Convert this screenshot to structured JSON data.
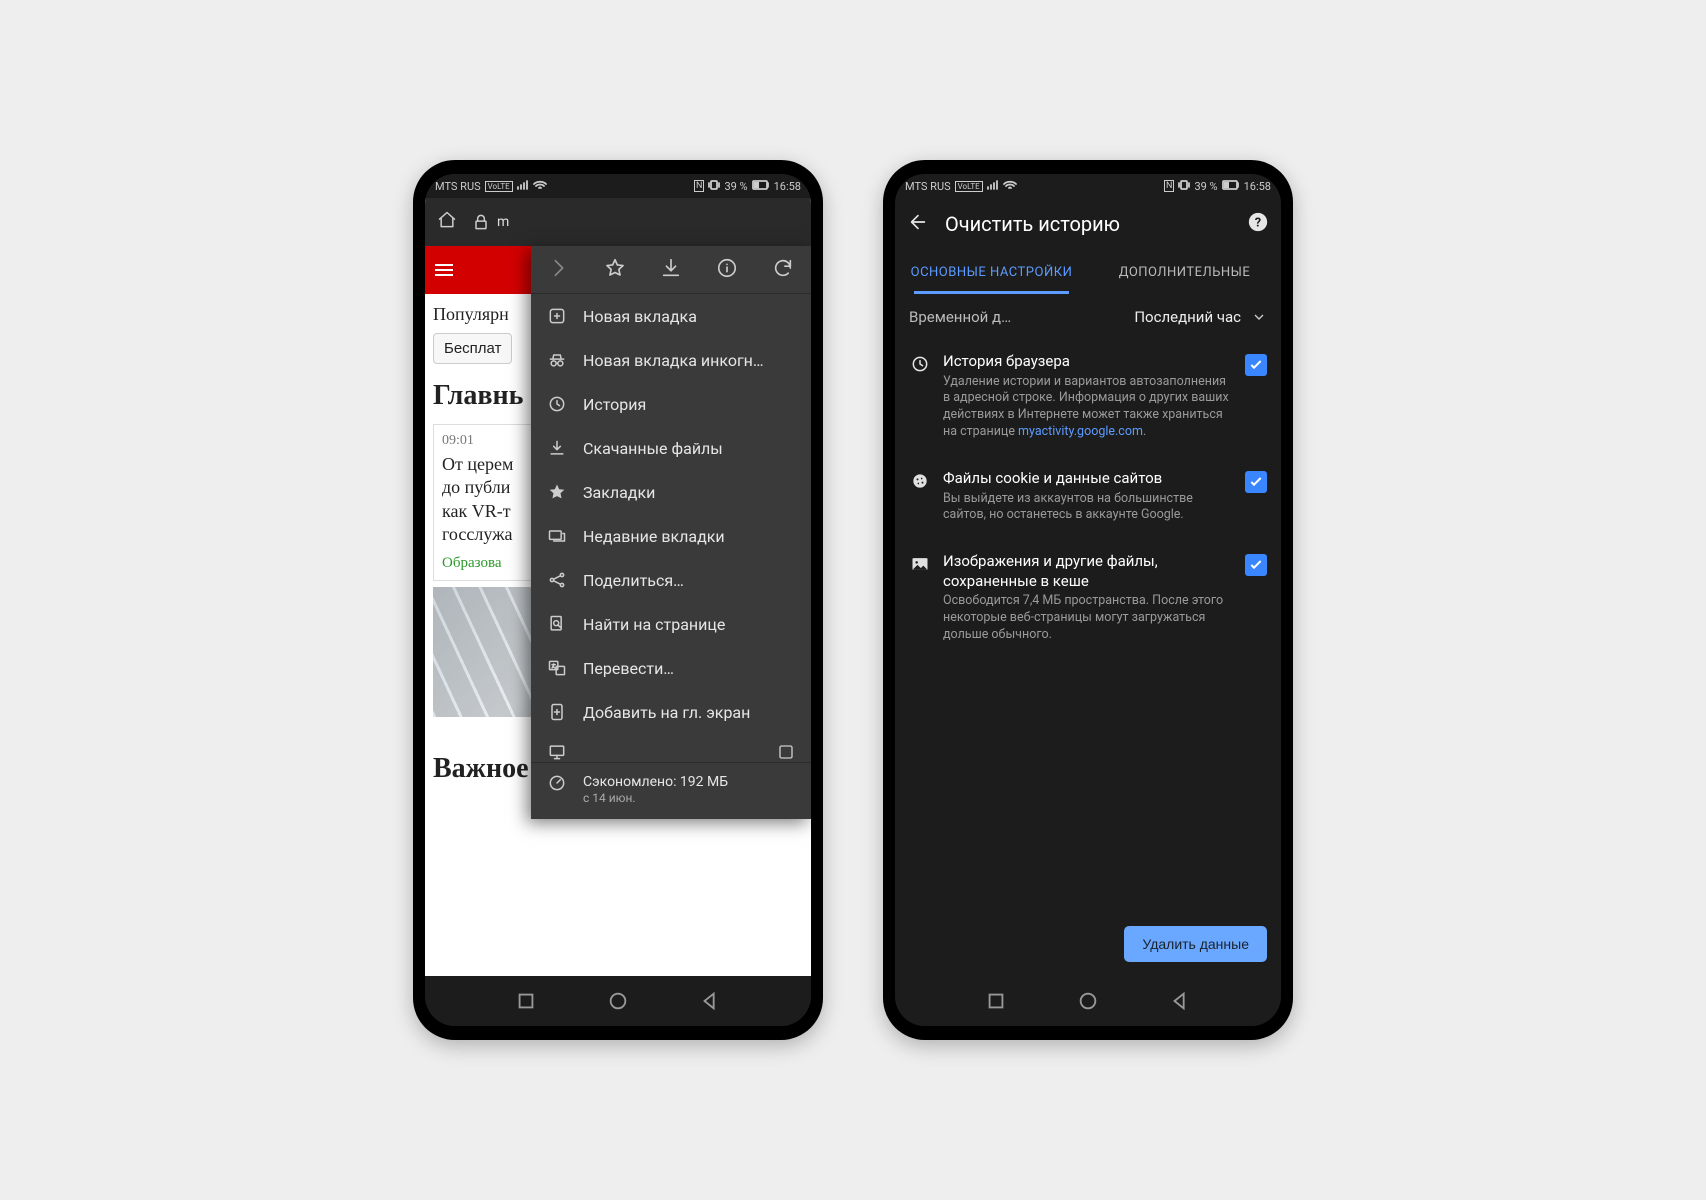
{
  "status": {
    "carrier": "MTS RUS",
    "volte": "VoLTE",
    "battery_text": "39 %",
    "time": "16:58"
  },
  "phone1": {
    "url_text": "m",
    "page": {
      "popular_label": "Популярн",
      "tag_chip": "Бесплат",
      "headline": "Главнь",
      "article_time": "09:01",
      "article_title": "От церем\nдо публи\nкак VR-т\nгосслужа",
      "article_tag": "Образова",
      "important": "Важное"
    },
    "menu": {
      "new_tab": "Новая вкладка",
      "incognito": "Новая вкладка инкогн…",
      "history": "История",
      "downloads": "Скачанные файлы",
      "bookmarks": "Закладки",
      "recent_tabs": "Недавние вкладки",
      "share": "Поделиться…",
      "find_in_page": "Найти на странице",
      "translate": "Перевести…",
      "add_home": "Добавить на гл. экран",
      "desktop_partial": "",
      "savings_line": "Сэкономлено: 192 МБ",
      "savings_sub": "с 14 июн."
    }
  },
  "phone2": {
    "title": "Очистить историю",
    "tab_basic": "ОСНОВНЫЕ НАСТРОЙКИ",
    "tab_advanced": "ДОПОЛНИТЕЛЬНЫЕ",
    "time_label": "Временной д…",
    "time_value": "Последний час",
    "opt_history_title": "История браузера",
    "opt_history_desc": "Удаление истории и вариантов автозаполнения в адресной строке. Информация о других ваших действиях в Интернете может также храниться на странице ",
    "opt_history_link": "myactivity.google.com",
    "opt_cookies_title": "Файлы cookie и данные сайтов",
    "opt_cookies_desc": "Вы выйдете из аккаунтов на большинстве сайтов, но останетесь в аккаунте Google.",
    "opt_cache_title": "Изображения и другие файлы, сохраненные в кеше",
    "opt_cache_desc": "Освободится 7,4 МБ пространства. После этого некоторые веб-страницы могут загружаться дольше обычного.",
    "delete_button": "Удалить данные"
  }
}
